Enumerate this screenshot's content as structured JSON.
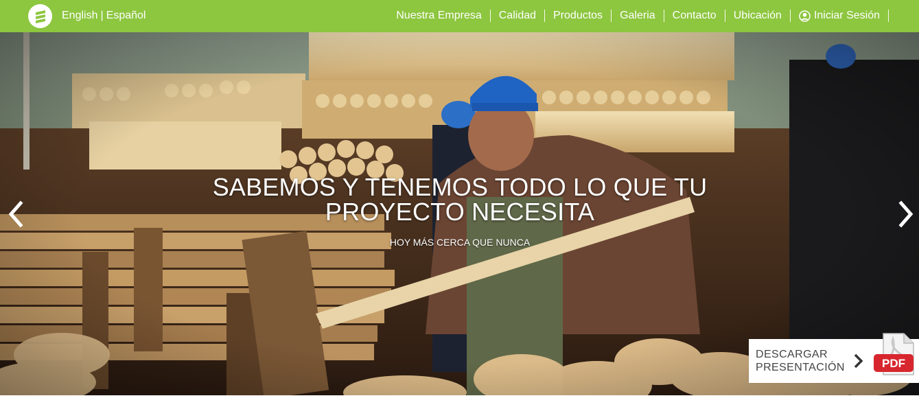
{
  "header": {
    "lang_english": "English",
    "lang_separator": "|",
    "lang_spanish": "Español",
    "nav": [
      {
        "label": "Nuestra Empresa"
      },
      {
        "label": "Calidad"
      },
      {
        "label": "Productos"
      },
      {
        "label": "Galeria"
      },
      {
        "label": "Contacto"
      },
      {
        "label": "Ubicación"
      },
      {
        "label": "Iniciar Sesión"
      }
    ],
    "icons": {
      "logo": "brand-logo-icon",
      "login": "user-circle-icon"
    }
  },
  "hero": {
    "title": "SABEMOS Y TENEMOS TODO LO QUE TU PROYECTO NECESITA",
    "subtitle": "HOY MÁS CERCA QUE NUNCA",
    "prev_icon": "chevron-left-icon",
    "next_icon": "chevron-right-icon"
  },
  "download": {
    "line1": "DESCARGAR",
    "line2": "PRESENTACIÓN",
    "pdf_label": "PDF",
    "icon": "pdf-file-icon"
  },
  "colors": {
    "brand_green": "#8dc63f",
    "white": "#ffffff",
    "pdf_red": "#d8262e",
    "text_gray": "#444444"
  }
}
